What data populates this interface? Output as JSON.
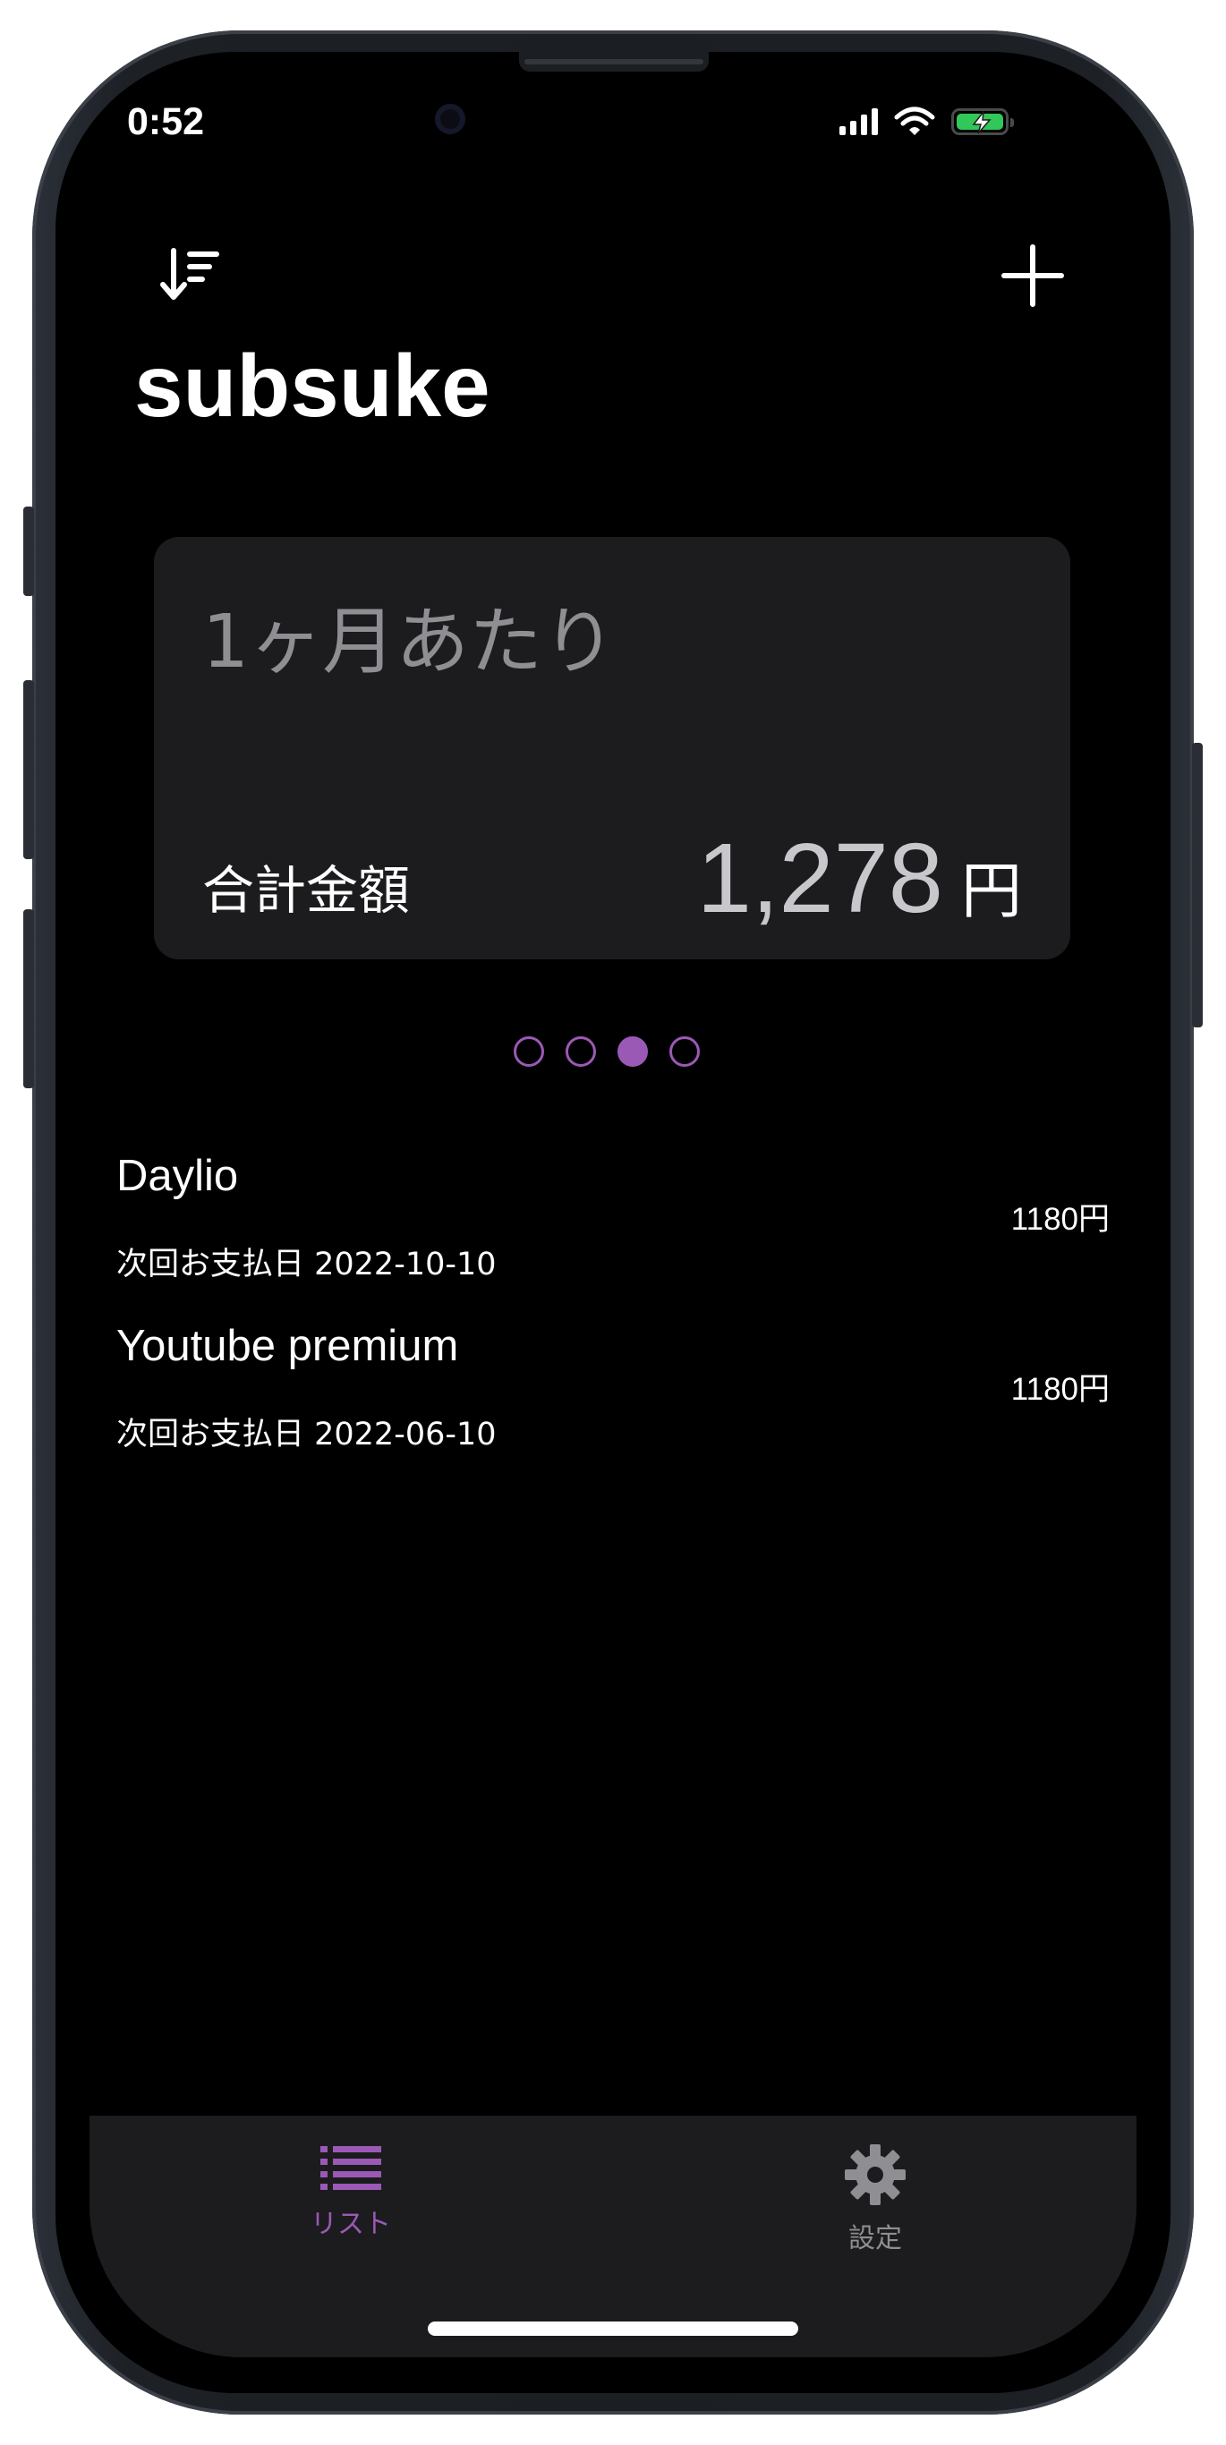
{
  "status_bar": {
    "time": "0:52"
  },
  "app": {
    "title": "subsuke"
  },
  "card": {
    "period": "1ヶ月あたり",
    "total_label": "合計金額",
    "total_value": "1,278",
    "currency": "円"
  },
  "pager": {
    "count": 4,
    "active_index": 2
  },
  "subscriptions": [
    {
      "name": "Daylio",
      "next_payment": "次回お支払日 2022-10-10",
      "price": "1180円"
    },
    {
      "name": "Youtube premium",
      "next_payment": "次回お支払日 2022-06-10",
      "price": "1180円"
    }
  ],
  "tab_bar": {
    "tabs": [
      {
        "label": "リスト",
        "icon": "list-icon",
        "selected": true
      },
      {
        "label": "設定",
        "icon": "gear-icon",
        "selected": false
      }
    ]
  },
  "colors": {
    "accent": "#9b59b6",
    "background": "#000000",
    "card": "#1c1c1e",
    "muted": "#8e8e93"
  }
}
